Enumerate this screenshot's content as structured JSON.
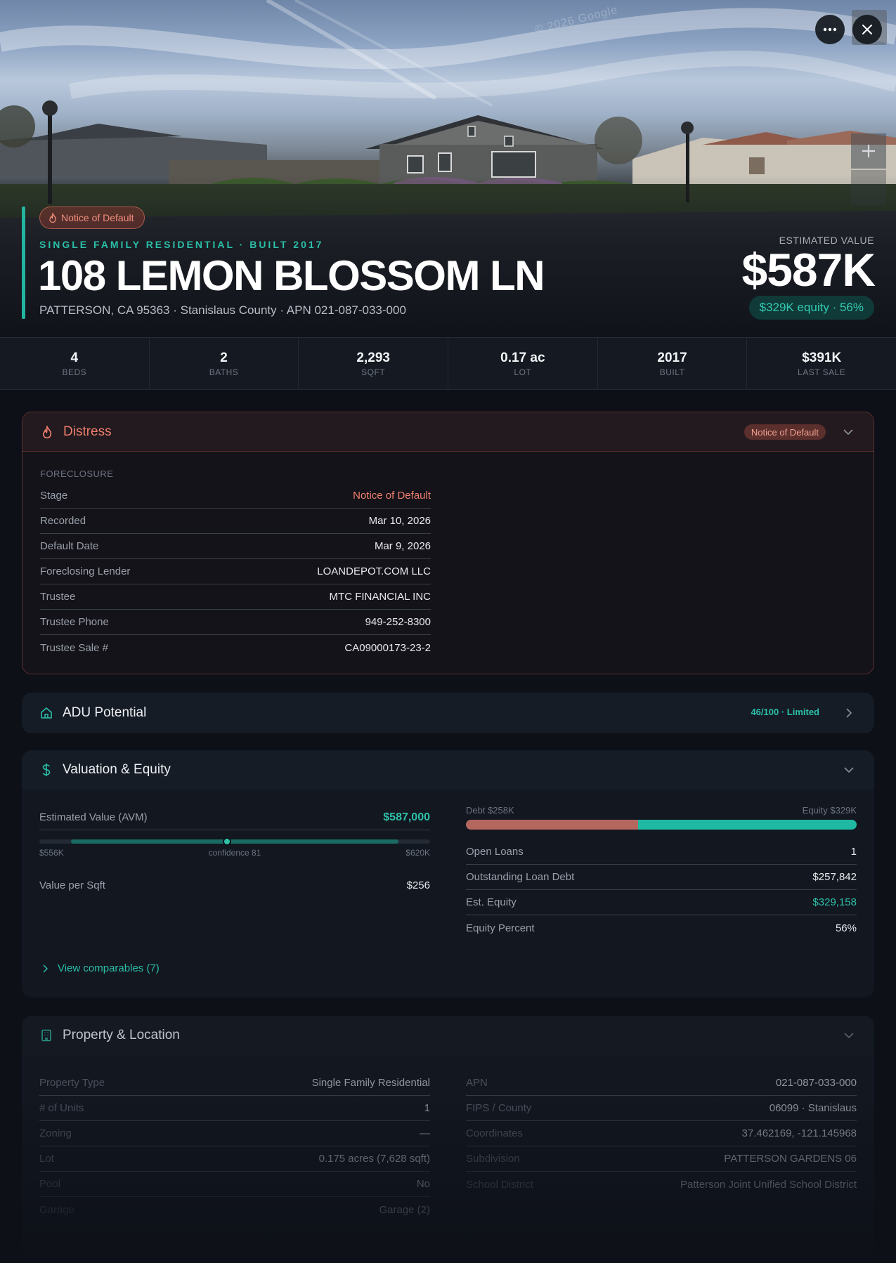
{
  "hero": {
    "watermark": "© 2026 Google",
    "status_pill": "Notice of Default",
    "subtitle": "SINGLE FAMILY RESIDENTIAL · BUILT 2017",
    "title": "108 LEMON BLOSSOM LN",
    "address": "PATTERSON, CA 95363 · Stanislaus County · APN 021-087-033-000",
    "estimated_label": "ESTIMATED VALUE",
    "estimated_value": "$587K",
    "equity_pill": "$329K equity · 56%"
  },
  "stats": [
    {
      "value": "4",
      "label": "BEDS"
    },
    {
      "value": "2",
      "label": "BATHS"
    },
    {
      "value": "2,293",
      "label": "SQFT"
    },
    {
      "value": "0.17 ac",
      "label": "LOT"
    },
    {
      "value": "2017",
      "label": "BUILT"
    },
    {
      "value": "$391K",
      "label": "LAST SALE"
    }
  ],
  "distress": {
    "title": "Distress",
    "badge": "Notice of Default",
    "section": "FORECLOSURE",
    "rows": [
      {
        "k": "Stage",
        "v": "Notice of Default"
      },
      {
        "k": "Recorded",
        "v": "Mar 10, 2026"
      },
      {
        "k": "Default Date",
        "v": "Mar 9, 2026"
      },
      {
        "k": "Foreclosing Lender",
        "v": "LOANDEPOT.COM LLC"
      },
      {
        "k": "Trustee",
        "v": "MTC FINANCIAL INC"
      },
      {
        "k": "Trustee Phone",
        "v": "949-252-8300"
      },
      {
        "k": "Trustee Sale #",
        "v": "CA09000173-23-2"
      }
    ]
  },
  "adu": {
    "title": "ADU Potential",
    "score": "46/100 · Limited"
  },
  "valuation": {
    "title": "Valuation & Equity",
    "avm_label": "Estimated Value (AVM)",
    "avm_value": "$587,000",
    "range_low": "$556K",
    "range_mid": "confidence 81",
    "range_high": "$620K",
    "range_position": 0.48,
    "per_sqft_label": "Value per Sqft",
    "per_sqft_value": "$256",
    "debt_label": "Debt $258K",
    "equity_label": "Equity $329K",
    "debt_fraction": 0.44,
    "rows": [
      {
        "k": "Open Loans",
        "v": "1"
      },
      {
        "k": "Outstanding Loan Debt",
        "v": "$257,842"
      },
      {
        "k": "Est. Equity",
        "v": "$329,158"
      },
      {
        "k": "Equity Percent",
        "v": "56%"
      }
    ],
    "comparables_link": "View comparables (7)"
  },
  "property": {
    "title": "Property & Location",
    "left": [
      {
        "k": "Property Type",
        "v": "Single Family Residential"
      },
      {
        "k": "# of Units",
        "v": "1"
      },
      {
        "k": "Zoning",
        "v": "—"
      },
      {
        "k": "Lot",
        "v": "0.175 acres (7,628 sqft)"
      },
      {
        "k": "Pool",
        "v": "No"
      },
      {
        "k": "Garage",
        "v": "Garage (2)"
      }
    ],
    "right": [
      {
        "k": "APN",
        "v": "021-087-033-000"
      },
      {
        "k": "FIPS / County",
        "v": "06099 · Stanislaus"
      },
      {
        "k": "Coordinates",
        "v": "37.462169, -121.145968"
      },
      {
        "k": "Subdivision",
        "v": "PATTERSON GARDENS 06"
      },
      {
        "k": "School District",
        "v": "Patterson Joint Unified School District"
      }
    ]
  },
  "colors": {
    "accent_teal": "#23b5a0",
    "distress_red": "#ef7e6c",
    "debt_bar": "#b3675f",
    "equity_bar": "#1fb8a3",
    "background": "#0d1017"
  },
  "icons": [
    "more-icon",
    "close-icon",
    "plus-icon",
    "flame-icon",
    "chevron-down-icon",
    "home-icon",
    "chevron-right-icon",
    "dollar-icon",
    "building-icon"
  ]
}
